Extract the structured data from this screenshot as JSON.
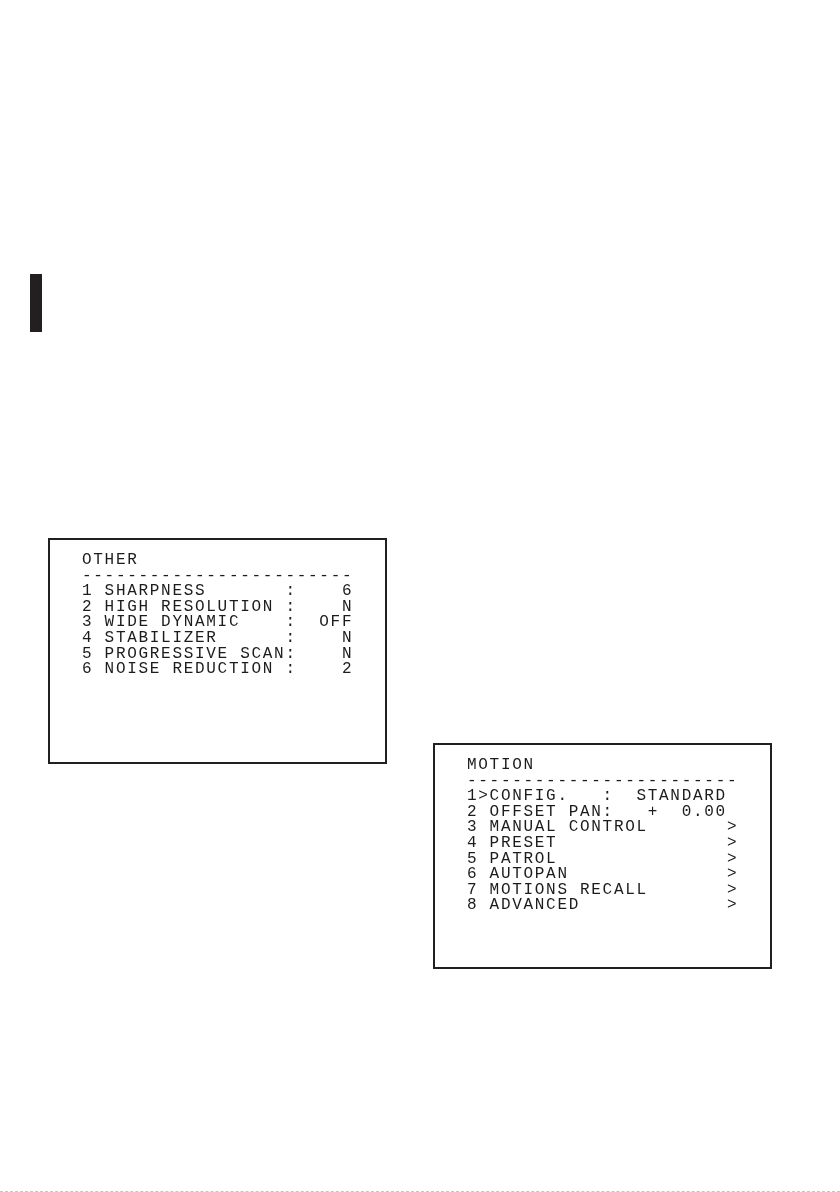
{
  "menus": [
    {
      "title": "OTHER",
      "separator": "------------------------",
      "rows": [
        {
          "kind": "setting",
          "number": "1",
          "label": "SHARPNESS",
          "colon": ":",
          "value": "6"
        },
        {
          "kind": "setting",
          "number": "2",
          "label": "HIGH RESOLUTION",
          "colon": ":",
          "value": "N"
        },
        {
          "kind": "setting",
          "number": "3",
          "label": "WIDE DYNAMIC",
          "colon": ":",
          "value": "OFF"
        },
        {
          "kind": "setting",
          "number": "4",
          "label": "STABILIZER",
          "colon": ":",
          "value": "N"
        },
        {
          "kind": "setting",
          "number": "5",
          "label": "PROGRESSIVE SCAN",
          "colon": ":",
          "value": "N"
        },
        {
          "kind": "setting",
          "number": "6",
          "label": "NOISE REDUCTION",
          "colon": ":",
          "value": "2"
        }
      ]
    },
    {
      "title": "MOTION",
      "separator": "------------------------",
      "cursor": ">",
      "rows": [
        {
          "kind": "setting",
          "number": "1",
          "selected": true,
          "label": "CONFIG.",
          "colon": ":",
          "value": "STANDARD"
        },
        {
          "kind": "setting",
          "number": "2",
          "selected": false,
          "label": "OFFSET PAN",
          "colon": ":",
          "value": "+  0.00"
        },
        {
          "kind": "submenu",
          "number": "3",
          "selected": false,
          "label": "MANUAL CONTROL",
          "arrow": ">"
        },
        {
          "kind": "submenu",
          "number": "4",
          "selected": false,
          "label": "PRESET",
          "arrow": ">"
        },
        {
          "kind": "submenu",
          "number": "5",
          "selected": false,
          "label": "PATROL",
          "arrow": ">"
        },
        {
          "kind": "submenu",
          "number": "6",
          "selected": false,
          "label": "AUTOPAN",
          "arrow": ">"
        },
        {
          "kind": "submenu",
          "number": "7",
          "selected": false,
          "label": "MOTIONS RECALL",
          "arrow": ">"
        },
        {
          "kind": "submenu",
          "number": "8",
          "selected": false,
          "label": "ADVANCED",
          "arrow": ">"
        }
      ]
    }
  ]
}
